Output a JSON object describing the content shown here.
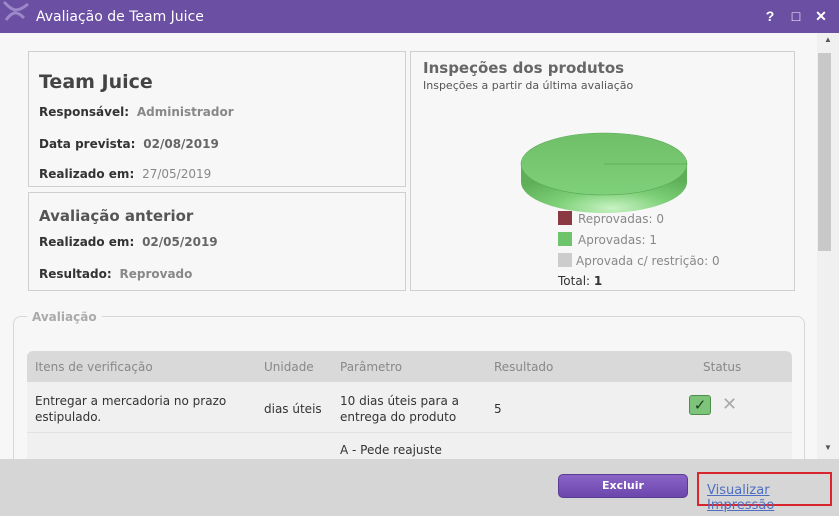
{
  "window": {
    "title": "Avaliação de Team Juice",
    "help": "?",
    "maximize": "□",
    "close": "✕"
  },
  "summary": {
    "name": "Team Juice",
    "responsavel_label": "Responsável:",
    "responsavel_value": "Administrador",
    "data_prevista_label": "Data prevista:",
    "data_prevista_value": "02/08/2019",
    "realizado_label": "Realizado em:",
    "realizado_value": "27/05/2019"
  },
  "previous": {
    "title": "Avaliação anterior",
    "realizado_label": "Realizado em:",
    "realizado_value": "02/05/2019",
    "resultado_label": "Resultado:",
    "resultado_value": "Reprovado"
  },
  "chart_data": {
    "type": "pie",
    "title": "Inspeções dos produtos",
    "subtitle": "Inspeções a partir da última avaliação",
    "categories": [
      "Reprovadas",
      "Aprovadas",
      "Aprovada c/ restrição"
    ],
    "values": [
      0,
      1,
      0
    ],
    "colors": [
      "#8b3a44",
      "#6fc46b",
      "#cccccc"
    ],
    "legend": [
      {
        "label": "Reprovadas:",
        "value": "0"
      },
      {
        "label": "Aprovadas:",
        "value": "1"
      },
      {
        "label": "Aprovada c/ restrição:",
        "value": "0"
      }
    ],
    "total_label": "Total:",
    "total_value": "1"
  },
  "evaluation": {
    "legend": "Avaliação",
    "headers": [
      "Itens de verificação",
      "Unidade",
      "Parâmetro",
      "Resultado",
      "Status"
    ],
    "rows": [
      {
        "item_line1": "Entregar a mercadoria no prazo",
        "item_line2": "estipulado.",
        "unidade": "dias úteis",
        "parametro_line1": "10 dias úteis para a",
        "parametro_line2": "entrega do produto",
        "resultado": "5",
        "status_ok": "✓",
        "status_reject": "✕"
      },
      {
        "parametro_line1": "A - Pede reajuste"
      }
    ]
  },
  "footer": {
    "delete_label": "Excluir",
    "print_label": "Visualizar Impressão"
  }
}
